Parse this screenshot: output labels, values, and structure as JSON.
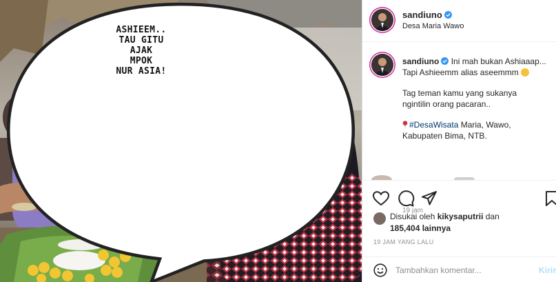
{
  "photo": {
    "speech_bubble": "ASHIEEM..\nTAU GITU\nAJAK\nMPOK\nNUR ASIA!"
  },
  "post_header": {
    "username": "sandiuno",
    "location": "Desa Maria Wawo",
    "verified_icon": "verified-badge-icon"
  },
  "caption": {
    "username": "sandiuno",
    "line1": "Ini mah bukan Ashiaaap...",
    "line2": "Tapi Ashieemm alias aseemmm",
    "line3": "Tag teman kamu yang sukanya",
    "line4": "ngintilin orang pacaran..",
    "hashtag": "#DesaWisata",
    "line5_rest": " Maria, Wawo,",
    "line6": "Kabupaten Bima, NTB.",
    "time": "19 jam"
  },
  "actions": {
    "like_icon": "heart-icon",
    "comment_icon": "comment-icon",
    "share_icon": "send-icon",
    "save_icon": "bookmark-icon"
  },
  "likes": {
    "prefix": "Disukai oleh ",
    "user": "kikysaputrii",
    "middle": " dan",
    "count": "185,404",
    "suffix": " lainnya"
  },
  "post_time": "19 JAM YANG LALU",
  "comment_box": {
    "placeholder": "Tambahkan komentar...",
    "send_label": "Kirim"
  },
  "colors": {
    "accent": "#0095f6",
    "verified": "#3897f0",
    "hashtag": "#00376b",
    "send_disabled": "#b2dffc"
  }
}
